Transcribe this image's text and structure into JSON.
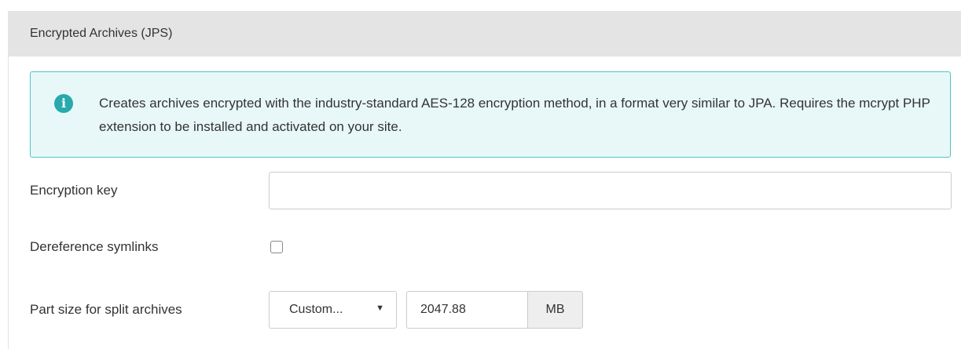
{
  "panel": {
    "title": "Encrypted Archives (JPS)"
  },
  "info": {
    "icon": "info-icon",
    "icon_glyph": "i",
    "text": "Creates archives encrypted with the industry-standard AES-128 encryption method, in a format very similar to JPA. Requires the mcrypt PHP extension to be installed and activated on your site.",
    "accent_color": "#27a9ad",
    "border_color": "#4fc3c8",
    "background_color": "#e8f8f8"
  },
  "fields": {
    "encryption_key": {
      "label": "Encryption key",
      "value": ""
    },
    "dereference_symlinks": {
      "label": "Dereference symlinks",
      "checked": false
    },
    "part_size": {
      "label": "Part size for split archives",
      "selected_option": "Custom...",
      "arrow_glyph": "▼",
      "value": "2047.88",
      "unit": "MB"
    }
  }
}
